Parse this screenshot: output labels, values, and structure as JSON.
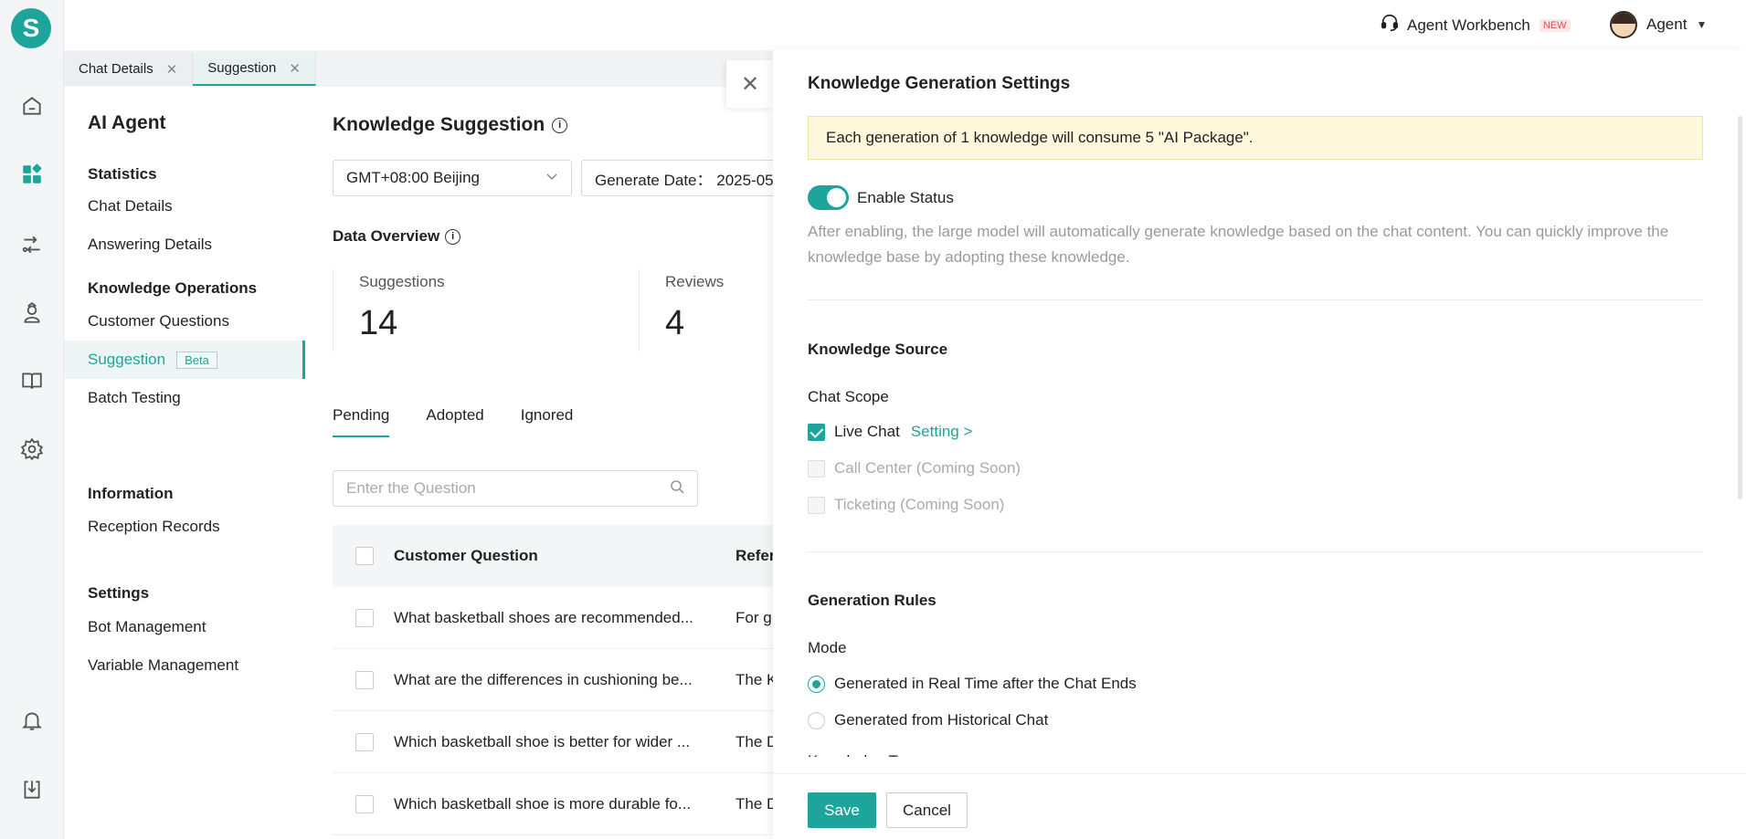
{
  "header": {
    "workbench_label": "Agent Workbench",
    "new_badge": "NEW",
    "user_name": "Agent"
  },
  "tabs": [
    {
      "label": "Chat Details"
    },
    {
      "label": "Suggestion"
    }
  ],
  "sidebar": {
    "title": "AI Agent",
    "groups": [
      {
        "heading": "Statistics",
        "items": [
          "Chat Details",
          "Answering Details"
        ]
      },
      {
        "heading": "Knowledge Operations",
        "items": [
          "Customer Questions",
          "Suggestion",
          "Batch Testing"
        ]
      },
      {
        "heading": "Information",
        "items": [
          "Reception Records"
        ]
      },
      {
        "heading": "Settings",
        "items": [
          "Bot Management",
          "Variable Management"
        ]
      }
    ],
    "beta_badge": "Beta",
    "active_item": "Suggestion"
  },
  "main": {
    "title": "Knowledge Suggestion",
    "timezone": "GMT+08:00 Beijing",
    "generate_date": "Generate Date： 2025-05",
    "data_overview": "Data Overview",
    "stats": [
      {
        "label": "Suggestions",
        "value": "14"
      },
      {
        "label": "Reviews",
        "value": "4"
      }
    ],
    "status_tabs": [
      "Pending",
      "Adopted",
      "Ignored"
    ],
    "search_placeholder": "Enter the Question",
    "columns": [
      "Customer Question",
      "Refer"
    ],
    "rows": [
      {
        "question": "What basketball shoes are recommended...",
        "ref": "For g"
      },
      {
        "question": "What are the differences in cushioning be...",
        "ref": "The K"
      },
      {
        "question": "Which basketball shoe is better for wider ...",
        "ref": "The D"
      },
      {
        "question": "Which basketball shoe is more durable fo...",
        "ref": "The D"
      }
    ]
  },
  "drawer": {
    "title": "Knowledge Generation Settings",
    "notice": "Each generation of 1 knowledge will consume 5 \"AI Package\".",
    "enable_label": "Enable Status",
    "enable_on": true,
    "enable_desc": "After enabling, the large model will automatically generate knowledge based on the chat content. You can quickly improve the knowledge base by adopting these knowledge.",
    "source_title": "Knowledge Source",
    "chat_scope_label": "Chat Scope",
    "scopes": [
      {
        "label": "Live Chat",
        "checked": true,
        "disabled": false,
        "link": "Setting >"
      },
      {
        "label": "Call Center (Coming Soon)",
        "checked": false,
        "disabled": true
      },
      {
        "label": "Ticketing (Coming Soon)",
        "checked": false,
        "disabled": true
      }
    ],
    "rules_title": "Generation Rules",
    "mode_label": "Mode",
    "modes": [
      {
        "label": "Generated in Real Time after the Chat Ends",
        "selected": true
      },
      {
        "label": "Generated from Historical Chat",
        "selected": false
      }
    ],
    "next_label": "Knowledge Type",
    "save_label": "Save",
    "cancel_label": "Cancel"
  },
  "colors": {
    "accent": "#1ea59b",
    "notice_bg": "#fdf7dc"
  }
}
